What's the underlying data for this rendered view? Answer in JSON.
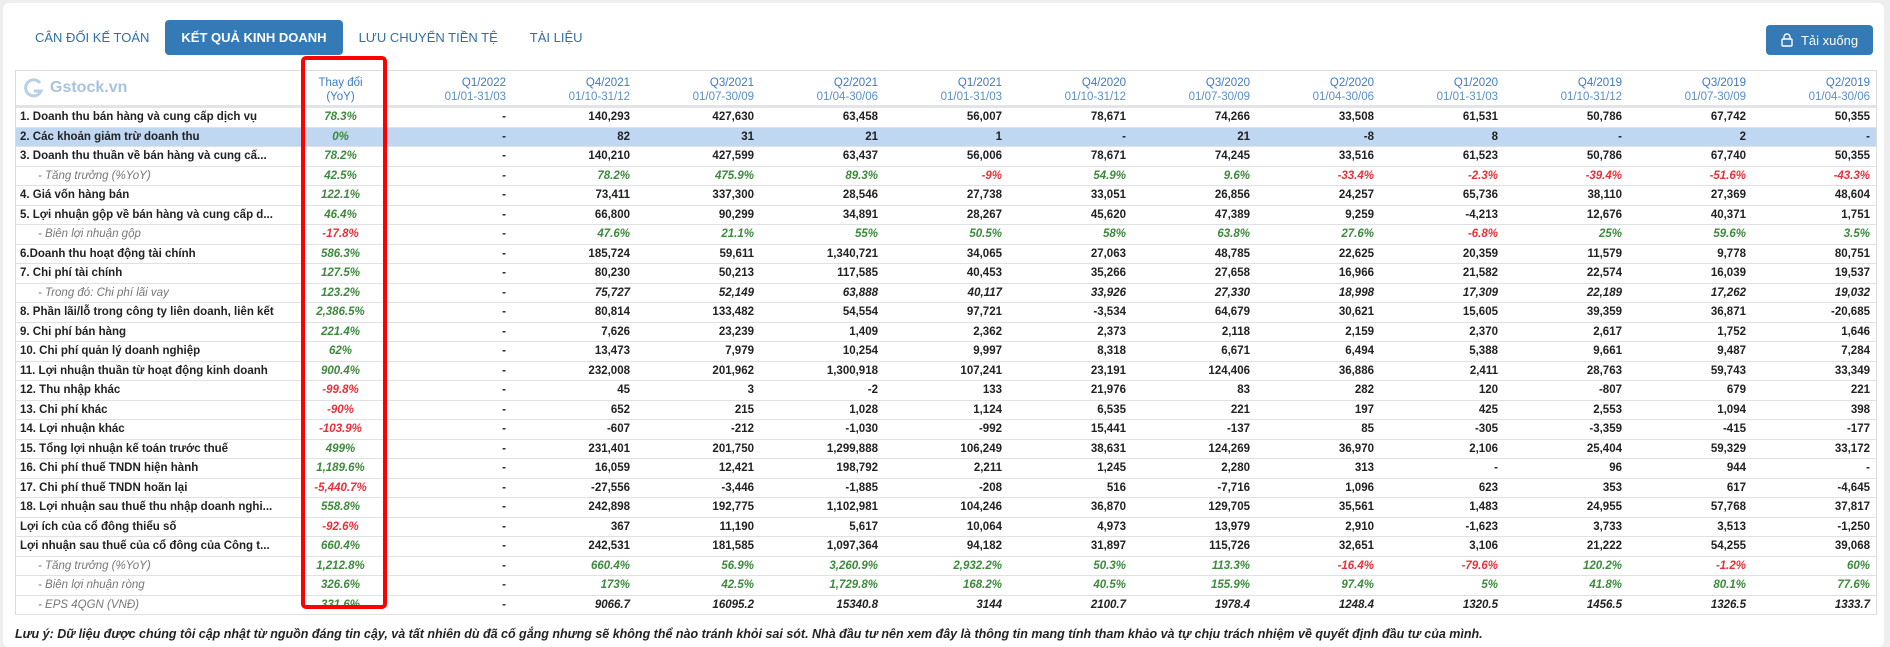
{
  "tabs": [
    "CÂN ĐỐI KẾ TOÁN",
    "KẾT QUẢ KINH DOANH",
    "LƯU CHUYỂN TIỀN TỆ",
    "TÀI LIỆU"
  ],
  "active_tab": 1,
  "download_label": "Tải xuống",
  "logo_text": "Gstock.vn",
  "change_header": [
    "Thay đổi",
    "(YoY)"
  ],
  "periods": [
    {
      "q": "Q1/2022",
      "d": "01/01-31/03"
    },
    {
      "q": "Q4/2021",
      "d": "01/10-31/12"
    },
    {
      "q": "Q3/2021",
      "d": "01/07-30/09"
    },
    {
      "q": "Q2/2021",
      "d": "01/04-30/06"
    },
    {
      "q": "Q1/2021",
      "d": "01/01-31/03"
    },
    {
      "q": "Q4/2020",
      "d": "01/10-31/12"
    },
    {
      "q": "Q3/2020",
      "d": "01/07-30/09"
    },
    {
      "q": "Q2/2020",
      "d": "01/04-30/06"
    },
    {
      "q": "Q1/2020",
      "d": "01/01-31/03"
    },
    {
      "q": "Q4/2019",
      "d": "01/10-31/12"
    },
    {
      "q": "Q3/2019",
      "d": "01/07-30/09"
    },
    {
      "q": "Q2/2019",
      "d": "01/04-30/06"
    }
  ],
  "rows": [
    {
      "label": "1. Doanh thu bán hàng và cung cấp dịch vụ",
      "type": "main",
      "change": "78.3%",
      "values": [
        "-",
        "140,293",
        "427,630",
        "63,458",
        "56,007",
        "78,671",
        "74,266",
        "33,508",
        "61,531",
        "50,786",
        "67,742",
        "50,355"
      ]
    },
    {
      "label": "2. Các khoản giảm trừ doanh thu",
      "type": "hl",
      "change": "0%",
      "values": [
        "-",
        "82",
        "31",
        "21",
        "1",
        "-",
        "21",
        "-8",
        "8",
        "-",
        "2",
        "-"
      ]
    },
    {
      "label": "3. Doanh thu thuần về bán hàng và cung cấ...",
      "type": "main",
      "change": "78.2%",
      "values": [
        "-",
        "140,210",
        "427,599",
        "63,437",
        "56,006",
        "78,671",
        "74,245",
        "33,516",
        "61,523",
        "50,786",
        "67,740",
        "50,355"
      ]
    },
    {
      "label": "- Tăng trưởng (%YoY)",
      "type": "pct",
      "change": "42.5%",
      "values": [
        "-",
        "78.2%",
        "475.9%",
        "89.3%",
        "-9%",
        "54.9%",
        "9.6%",
        "-33.4%",
        "-2.3%",
        "-39.4%",
        "-51.6%",
        "-43.3%"
      ]
    },
    {
      "label": "4. Giá vốn hàng bán",
      "type": "main",
      "change": "122.1%",
      "values": [
        "-",
        "73,411",
        "337,300",
        "28,546",
        "27,738",
        "33,051",
        "26,856",
        "24,257",
        "65,736",
        "38,110",
        "27,369",
        "48,604"
      ]
    },
    {
      "label": "5. Lợi nhuận gộp về bán hàng và cung cấp d...",
      "type": "main",
      "change": "46.4%",
      "values": [
        "-",
        "66,800",
        "90,299",
        "34,891",
        "28,267",
        "45,620",
        "47,389",
        "9,259",
        "-4,213",
        "12,676",
        "40,371",
        "1,751"
      ]
    },
    {
      "label": "- Biên lợi nhuận gộp",
      "type": "pct",
      "change": "-17.8%",
      "values": [
        "-",
        "47.6%",
        "21.1%",
        "55%",
        "50.5%",
        "58%",
        "63.8%",
        "27.6%",
        "-6.8%",
        "25%",
        "59.6%",
        "3.5%"
      ]
    },
    {
      "label": "6.Doanh thu hoạt động tài chính",
      "type": "main",
      "change": "586.3%",
      "values": [
        "-",
        "185,724",
        "59,611",
        "1,340,721",
        "34,065",
        "27,063",
        "48,785",
        "22,625",
        "20,359",
        "11,579",
        "9,778",
        "80,751"
      ]
    },
    {
      "label": "7. Chi phí tài chính",
      "type": "main",
      "change": "127.5%",
      "values": [
        "-",
        "80,230",
        "50,213",
        "117,585",
        "40,453",
        "35,266",
        "27,658",
        "16,966",
        "21,582",
        "22,574",
        "16,039",
        "19,537"
      ]
    },
    {
      "label": "- Trong đó: Chi phí lãi vay",
      "type": "subnum",
      "change": "123.2%",
      "values": [
        "-",
        "75,727",
        "52,149",
        "63,888",
        "40,117",
        "33,926",
        "27,330",
        "18,998",
        "17,309",
        "22,189",
        "17,262",
        "19,032"
      ]
    },
    {
      "label": "8. Phần lãi/lỗ trong công ty liên doanh, liên kết",
      "type": "main",
      "change": "2,386.5%",
      "values": [
        "-",
        "80,814",
        "133,482",
        "54,554",
        "97,721",
        "-3,534",
        "64,679",
        "30,621",
        "15,605",
        "39,359",
        "36,871",
        "-20,685"
      ]
    },
    {
      "label": "9. Chi phí bán hàng",
      "type": "main",
      "change": "221.4%",
      "values": [
        "-",
        "7,626",
        "23,239",
        "1,409",
        "2,362",
        "2,373",
        "2,118",
        "2,159",
        "2,370",
        "2,617",
        "1,752",
        "1,646"
      ]
    },
    {
      "label": "10. Chi phí quản lý doanh nghiệp",
      "type": "main",
      "change": "62%",
      "values": [
        "-",
        "13,473",
        "7,979",
        "10,254",
        "9,997",
        "8,318",
        "6,671",
        "6,494",
        "5,388",
        "9,661",
        "9,487",
        "7,284"
      ]
    },
    {
      "label": "11. Lợi nhuận thuần từ hoạt động kinh doanh",
      "type": "main",
      "change": "900.4%",
      "values": [
        "-",
        "232,008",
        "201,962",
        "1,300,918",
        "107,241",
        "23,191",
        "124,406",
        "36,886",
        "2,411",
        "28,763",
        "59,743",
        "33,349"
      ]
    },
    {
      "label": "12. Thu nhập khác",
      "type": "main",
      "change": "-99.8%",
      "values": [
        "-",
        "45",
        "3",
        "-2",
        "133",
        "21,976",
        "83",
        "282",
        "120",
        "-807",
        "679",
        "221"
      ]
    },
    {
      "label": "13. Chi phí khác",
      "type": "main",
      "change": "-90%",
      "values": [
        "-",
        "652",
        "215",
        "1,028",
        "1,124",
        "6,535",
        "221",
        "197",
        "425",
        "2,553",
        "1,094",
        "398"
      ]
    },
    {
      "label": "14. Lợi nhuận khác",
      "type": "main",
      "change": "-103.9%",
      "values": [
        "-",
        "-607",
        "-212",
        "-1,030",
        "-992",
        "15,441",
        "-137",
        "85",
        "-305",
        "-3,359",
        "-415",
        "-177"
      ]
    },
    {
      "label": "15. Tổng lợi nhuận kế toán trước thuế",
      "type": "main",
      "change": "499%",
      "values": [
        "-",
        "231,401",
        "201,750",
        "1,299,888",
        "106,249",
        "38,631",
        "124,269",
        "36,970",
        "2,106",
        "25,404",
        "59,329",
        "33,172"
      ]
    },
    {
      "label": "16. Chi phí thuế TNDN hiện hành",
      "type": "main",
      "change": "1,189.6%",
      "values": [
        "-",
        "16,059",
        "12,421",
        "198,792",
        "2,211",
        "1,245",
        "2,280",
        "313",
        "-",
        "96",
        "944",
        "-"
      ]
    },
    {
      "label": "17. Chi phí thuế TNDN hoãn lại",
      "type": "main",
      "change": "-5,440.7%",
      "values": [
        "-",
        "-27,556",
        "-3,446",
        "-1,885",
        "-208",
        "516",
        "-7,716",
        "1,096",
        "623",
        "353",
        "617",
        "-4,645"
      ]
    },
    {
      "label": "18. Lợi nhuận sau thuế thu nhập doanh nghi...",
      "type": "main",
      "change": "558.8%",
      "values": [
        "-",
        "242,898",
        "192,775",
        "1,102,981",
        "104,246",
        "36,870",
        "129,705",
        "35,561",
        "1,483",
        "24,955",
        "57,768",
        "37,817"
      ]
    },
    {
      "label": "Lợi ích của cổ đông thiểu số",
      "type": "main",
      "change": "-92.6%",
      "values": [
        "-",
        "367",
        "11,190",
        "5,617",
        "10,064",
        "4,973",
        "13,979",
        "2,910",
        "-1,623",
        "3,733",
        "3,513",
        "-1,250"
      ]
    },
    {
      "label": "Lợi nhuận sau thuế của cổ đông của Công t...",
      "type": "main",
      "change": "660.4%",
      "values": [
        "-",
        "242,531",
        "181,585",
        "1,097,364",
        "94,182",
        "31,897",
        "115,726",
        "32,651",
        "3,106",
        "21,222",
        "54,255",
        "39,068"
      ]
    },
    {
      "label": "- Tăng trưởng (%YoY)",
      "type": "pct",
      "change": "1,212.8%",
      "values": [
        "-",
        "660.4%",
        "56.9%",
        "3,260.9%",
        "2,932.2%",
        "50.3%",
        "113.3%",
        "-16.4%",
        "-79.6%",
        "120.2%",
        "-1.2%",
        "60%"
      ]
    },
    {
      "label": "- Biên lợi nhuận ròng",
      "type": "pct",
      "change": "326.6%",
      "values": [
        "-",
        "173%",
        "42.5%",
        "1,729.8%",
        "168.2%",
        "40.5%",
        "155.9%",
        "97.4%",
        "5%",
        "41.8%",
        "80.1%",
        "77.6%"
      ]
    },
    {
      "label": "- EPS 4QGN (VNĐ)",
      "type": "subnum",
      "change": "331.6%",
      "values": [
        "-",
        "9066.7",
        "16095.2",
        "15340.8",
        "3144",
        "2100.7",
        "1978.4",
        "1248.4",
        "1320.5",
        "1456.5",
        "1326.5",
        "1333.7"
      ]
    }
  ],
  "note": "Lưu ý: Dữ liệu được chúng tôi cập nhật từ nguồn đáng tin cậy, và tất nhiên dù đã cố gắng nhưng sẽ không thể nào tránh khỏi sai sót. Nhà đầu tư nên xem đây là thông tin mang tính tham khảo và tự chịu trách nhiệm về quyết định đầu tư của mình.",
  "colors": {
    "accent": "#337ab7",
    "positive": "#3c8a3c",
    "negative": "#e8303a",
    "highlight_row": "#bfd7f1",
    "annotation_box": "#ff0000"
  }
}
